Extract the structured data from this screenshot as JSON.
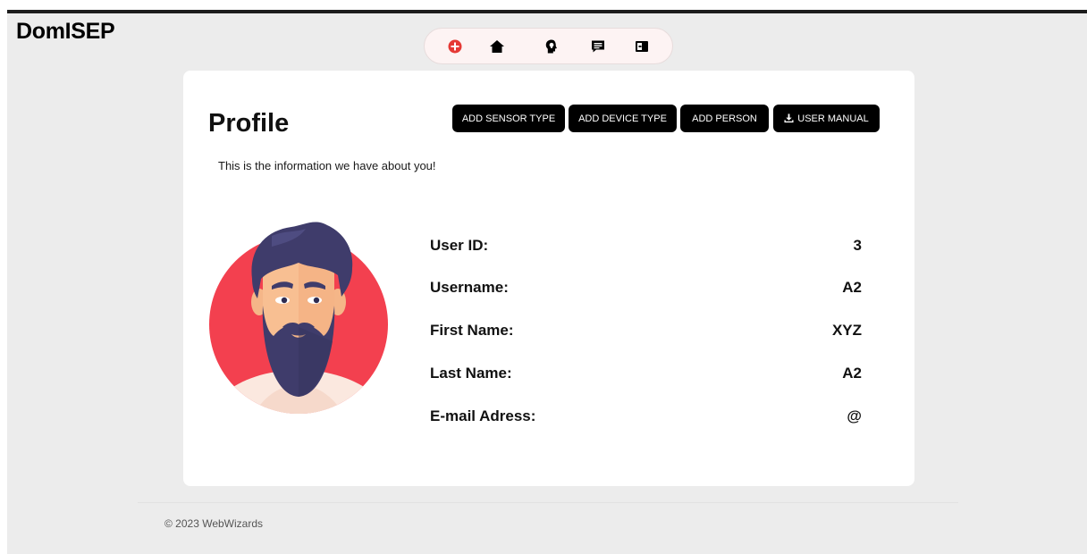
{
  "header": {
    "brand": "DomISEP",
    "nav": [
      {
        "icon": "plus-circle-icon",
        "color": "#e53935"
      },
      {
        "icon": "home-icon",
        "color": "#000000"
      },
      {
        "icon": "head-lightbulb-icon",
        "color": "#000000"
      },
      {
        "icon": "message-icon",
        "color": "#000000"
      },
      {
        "icon": "logout-icon",
        "color": "#000000"
      }
    ]
  },
  "profile": {
    "title": "Profile",
    "subtitle": "This is the information we have about you!",
    "buttons": {
      "add_sensor_type": "ADD SENSOR TYPE",
      "add_device_type": "ADD DEVICE TYPE",
      "add_person": "ADD PERSON",
      "user_manual": "USER MANUAL"
    },
    "fields": [
      {
        "label": "User ID:",
        "value": "3"
      },
      {
        "label": "Username:",
        "value": "A2"
      },
      {
        "label": "First Name:",
        "value": "XYZ"
      },
      {
        "label": "Last Name:",
        "value": "A2"
      },
      {
        "label": "E-mail Adress:",
        "value": "@"
      }
    ]
  },
  "footer": {
    "text": "© 2023 WebWizards"
  },
  "colors": {
    "background": "#ececec",
    "card": "#ffffff",
    "button": "#000000",
    "accent": "#f3404f"
  }
}
